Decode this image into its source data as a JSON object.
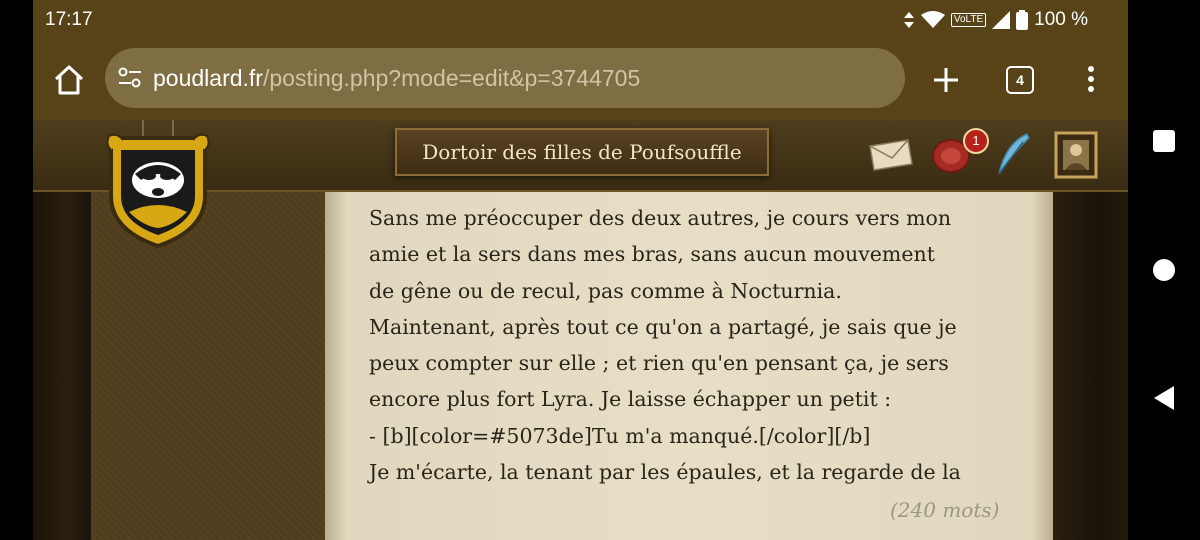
{
  "status_bar": {
    "time": "17:17",
    "battery": "100 %",
    "network": "VoLTE"
  },
  "browser": {
    "url_host": "poudlard.fr",
    "url_path": "/posting.php?mode=edit&p=3744705",
    "tab_count": "4"
  },
  "site_header": {
    "house_title": "Dortoir des filles de Poufsouffle",
    "notification_count": "1"
  },
  "post": {
    "lines": [
      "Sans me préoccuper des deux autres, je cours vers mon",
      "amie et la sers dans mes bras, sans aucun mouvement",
      "de gêne ou de recul, pas comme à Nocturnia.",
      "Maintenant, après tout ce qu'on a partagé, je sais que je",
      "peux compter sur elle ; et rien qu'en pensant ça, je sers",
      "encore plus fort Lyra. Je laisse échapper un petit :",
      "- [b][color=#5073de]Tu m'a manqué.[/color][/b]",
      "Je m'écarte, la tenant par les épaules, et la regarde de la"
    ],
    "word_count": "(240 mots)"
  },
  "colors": {
    "toolbar": "#584318",
    "urlbar": "#7f6d44",
    "parchment": "#e6dfc6",
    "house_yellow": "#e8b818"
  }
}
